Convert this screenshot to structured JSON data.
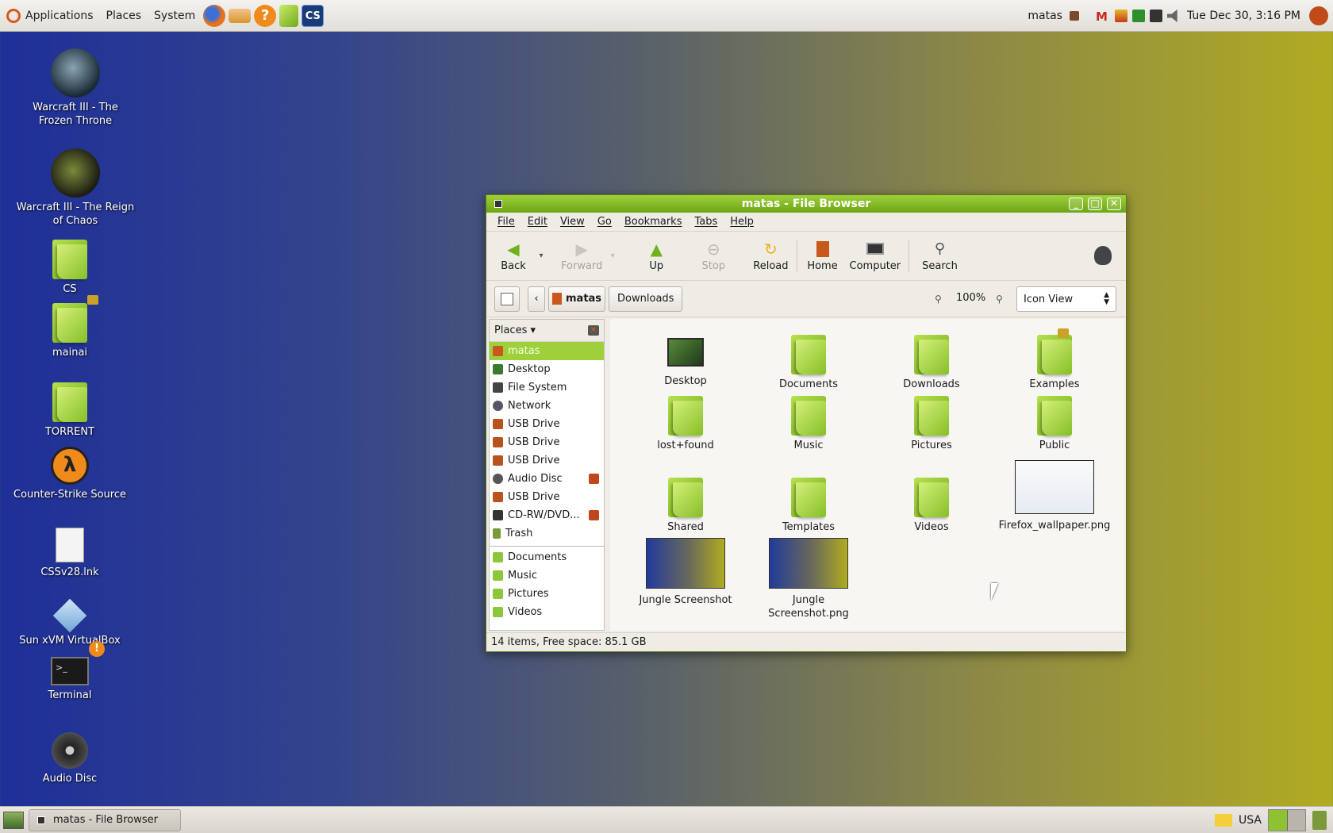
{
  "top_panel": {
    "menus": [
      "Applications",
      "Places",
      "System"
    ],
    "launchers": [
      "firefox-icon",
      "mail-icon",
      "help-icon",
      "folder-icon",
      "cs-icon"
    ],
    "user": "matas",
    "datetime": "Tue Dec 30,  3:16 PM"
  },
  "desktop": {
    "icons": [
      {
        "label": "Warcraft III - The Frozen Throne",
        "icon": "warcraft-frozen-throne-icon"
      },
      {
        "label": "Warcraft III - The Reign of Chaos",
        "icon": "warcraft-reign-of-chaos-icon"
      },
      {
        "label": "CS",
        "icon": "folder-icon"
      },
      {
        "label": "mainai",
        "icon": "locked-folder-icon"
      },
      {
        "label": "TORRENT",
        "icon": "folder-icon"
      },
      {
        "label": "Counter-Strike Source",
        "icon": "half-life-icon"
      },
      {
        "label": "CSSv28.lnk",
        "icon": "document-icon"
      },
      {
        "label": "Sun xVM VirtualBox",
        "icon": "virtualbox-icon"
      },
      {
        "label": "Terminal",
        "icon": "terminal-icon"
      },
      {
        "label": "Audio Disc",
        "icon": "audio-disc-icon"
      }
    ]
  },
  "window": {
    "title": "matas - File Browser",
    "menu": [
      "File",
      "Edit",
      "View",
      "Go",
      "Bookmarks",
      "Tabs",
      "Help"
    ],
    "toolbar": {
      "back": "Back",
      "forward": "Forward",
      "up": "Up",
      "stop": "Stop",
      "reload": "Reload",
      "home": "Home",
      "computer": "Computer",
      "search": "Search"
    },
    "location": {
      "crumb1": "matas",
      "crumb2": "Downloads",
      "zoom": "100%",
      "view": "Icon View"
    },
    "sidebar": {
      "header": "Places",
      "items": [
        "matas",
        "Desktop",
        "File System",
        "Network",
        "USB Drive",
        "USB Drive",
        "USB Drive",
        "Audio Disc",
        "USB Drive",
        "CD-RW/DVD...",
        "Trash"
      ],
      "bookmarks": [
        "Documents",
        "Music",
        "Pictures",
        "Videos"
      ]
    },
    "files": [
      "Desktop",
      "Documents",
      "Downloads",
      "Examples",
      "lost+found",
      "Music",
      "Pictures",
      "Public",
      "Shared",
      "Templates",
      "Videos",
      "Firefox_wallpaper.png",
      "Jungle Screenshot",
      "Jungle Screenshot.png"
    ],
    "status": "14 items, Free space: 85.1 GB"
  },
  "bottom_panel": {
    "task": "matas - File Browser",
    "keyboard": "USA"
  },
  "colors": {
    "accent": "#8fc232",
    "title_green": "#7cb51f",
    "eject": "#c0461b"
  }
}
